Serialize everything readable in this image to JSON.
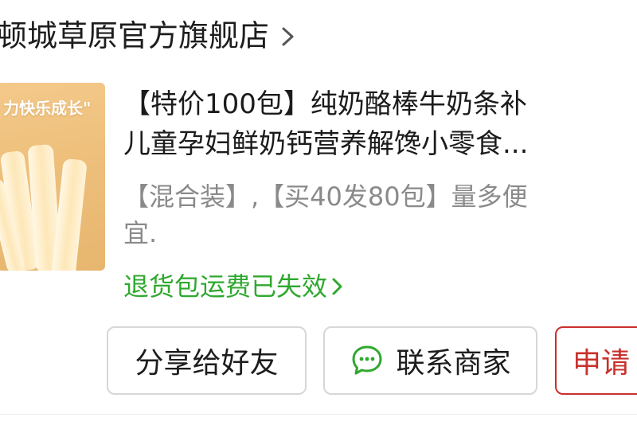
{
  "store": {
    "name": "顿城草原官方旗舰店",
    "chevron_icon": "chevron-right-icon"
  },
  "product": {
    "thumbnail_text": "力快乐成长\"",
    "title_lines": [
      "【特价100包】纯奶酪棒牛奶条补",
      "儿童孕妇鲜奶钙营养解馋小零食..."
    ],
    "spec_lines": [
      "【混合装】,【买40发80包】量多便",
      "宜."
    ]
  },
  "return_notice": {
    "label": "退货包运费已失效",
    "color": "#2fa82f"
  },
  "actions": {
    "share_label": "分享给好友",
    "contact_label": "联系商家",
    "contact_icon": "chat-bubble-icon",
    "apply_label": "申请",
    "accent": "#c9302c"
  }
}
